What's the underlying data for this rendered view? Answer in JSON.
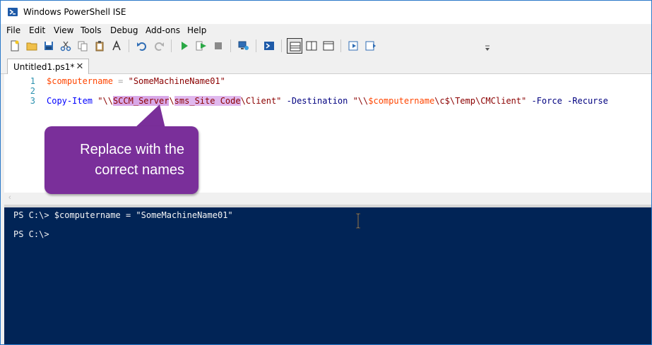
{
  "window": {
    "title": "Windows PowerShell ISE"
  },
  "menu": {
    "items": [
      "File",
      "Edit",
      "View",
      "Tools",
      "Debug",
      "Add-ons",
      "Help"
    ]
  },
  "toolbar": {
    "buttons": [
      "new-script",
      "open-script",
      "save-script",
      "cut",
      "copy",
      "paste",
      "clear-console",
      "undo",
      "redo",
      "run-script",
      "run-selection",
      "stop",
      "new-remote-tab",
      "start-powershell",
      "show-script-pane-top",
      "show-script-pane-right",
      "show-script-pane-max",
      "show-command-window",
      "show-command-addon"
    ]
  },
  "tab": {
    "label": "Untitled1.ps1*",
    "close": "✕"
  },
  "editor": {
    "line_numbers": [
      "1",
      "2",
      "3"
    ],
    "line1": {
      "var": "$computername",
      "op": " = ",
      "str": "\"SomeMachineName01\""
    },
    "line3": {
      "cmd": "Copy-Item",
      "sp1": " ",
      "str_a": "\"\\\\",
      "hl1": "SCCM_Server",
      "str_b": "\\",
      "hl2": "sms_Site Code",
      "str_c": "\\Client\"",
      "sp2": " ",
      "param1": "-Destination",
      "sp3": " ",
      "str_d": "\"\\\\",
      "var": "$computername",
      "str_e": "\\c$\\Temp\\CMClient\"",
      "sp4": " ",
      "param2": "-Force",
      "sp5": " ",
      "param3": "-Recurse"
    }
  },
  "callout": {
    "line1": "Replace with the",
    "line2": "correct names"
  },
  "console": {
    "lines": [
      "PS C:\\> $computername = \"SomeMachineName01\"",
      "PS C:\\>"
    ]
  },
  "colors": {
    "console_bg": "#012456",
    "callout_bg": "#7a2f9a",
    "highlight": "#d8a8e8",
    "variable": "#ff4500",
    "string": "#8b0000",
    "cmdlet": "#0000ff",
    "parameter": "#000080"
  }
}
